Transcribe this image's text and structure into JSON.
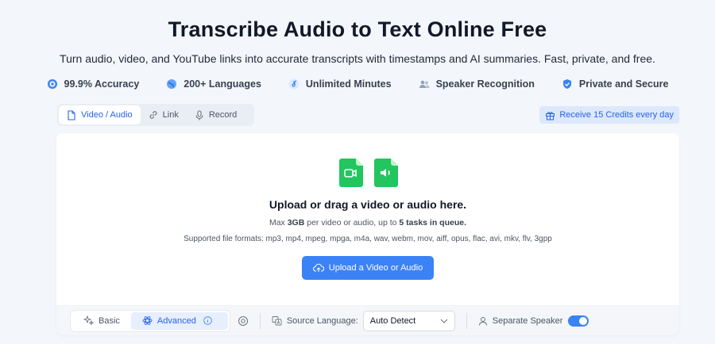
{
  "header": {
    "title": "Transcribe Audio to Text Online Free",
    "subtitle": "Turn audio, video, and YouTube links into accurate transcripts with timestamps and AI summaries. Fast, private, and free."
  },
  "features": [
    {
      "label": "99.9% Accuracy",
      "icon": "target-icon"
    },
    {
      "label": "200+ Languages",
      "icon": "globe-icon"
    },
    {
      "label": "Unlimited Minutes",
      "icon": "music-note-icon"
    },
    {
      "label": "Speaker Recognition",
      "icon": "users-icon"
    },
    {
      "label": "Private and Secure",
      "icon": "shield-icon"
    }
  ],
  "tabs": [
    {
      "label": "Video / Audio",
      "active": true
    },
    {
      "label": "Link",
      "active": false
    },
    {
      "label": "Record",
      "active": false
    }
  ],
  "credits": {
    "label": "Receive 15 Credits every day"
  },
  "upload": {
    "title": "Upload or drag a video or audio here.",
    "limits_prefix": "Max ",
    "limits_size": "3GB",
    "limits_mid": " per video or audio, up to ",
    "limits_tasks": "5 tasks in queue.",
    "formats": "Supported file formats: mp3, mp4, mpeg, mpga, m4a, wav, webm, mov, aiff, opus, flac, avi, mkv, flv, 3gpp",
    "button_label": "Upload a Video or Audio"
  },
  "toolbar": {
    "mode_basic": "Basic",
    "mode_advanced": "Advanced",
    "source_language_label": "Source Language:",
    "source_language_value": "Auto Detect",
    "separate_speaker_label": "Separate Speaker",
    "separate_speaker_on": true
  },
  "colors": {
    "accent": "#3b82f6",
    "file_icon": "#22c55e",
    "background": "#f3f6fb"
  }
}
